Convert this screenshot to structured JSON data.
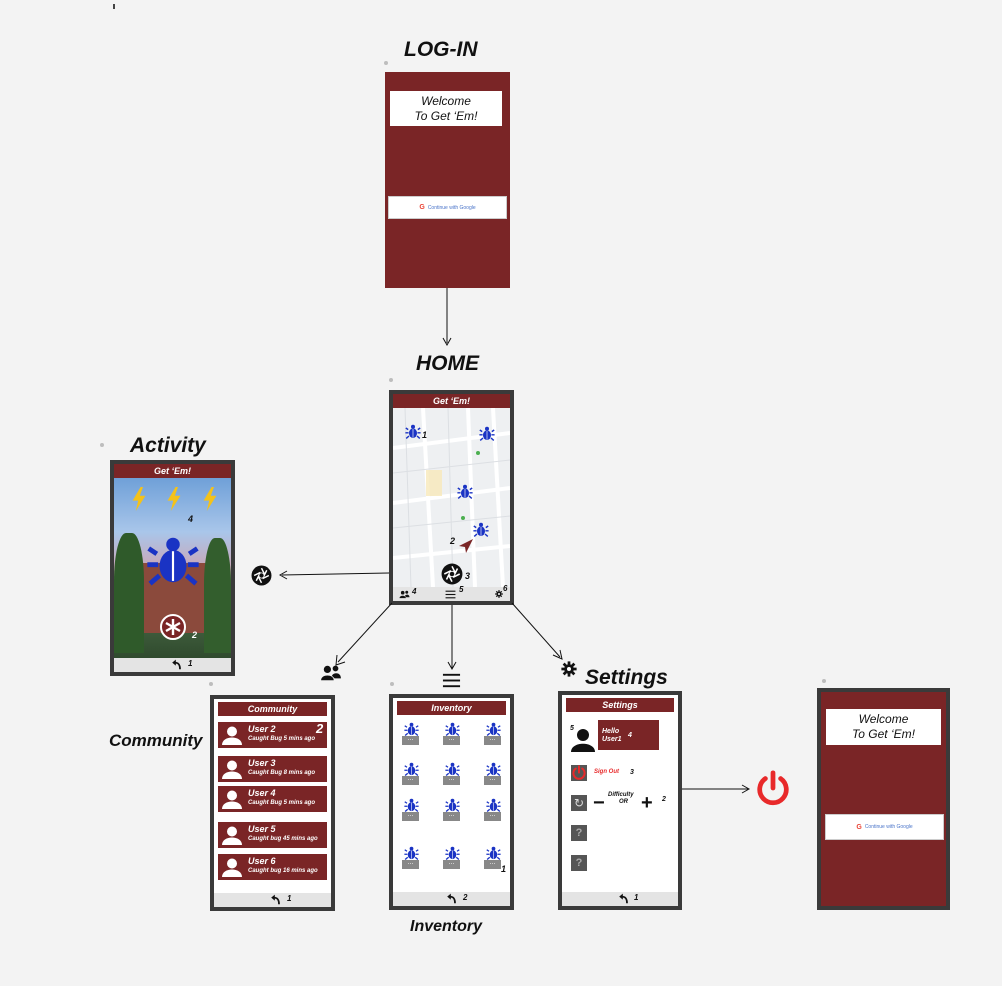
{
  "titles": {
    "login": "LOG-IN",
    "home": "HOME",
    "activity": "Activity",
    "community": "Community",
    "inventory": "Inventory",
    "settings": "Settings"
  },
  "login": {
    "welcome_line1": "Welcome",
    "welcome_line2": "To Get ‘Em!",
    "google_label": "Continue with Google"
  },
  "home": {
    "app_title": "Get ‘Em!",
    "labels": {
      "bug1": "1",
      "arrow": "2",
      "camera": "3",
      "nav_community": "4",
      "nav_inventory": "5",
      "nav_settings": "6"
    }
  },
  "activity": {
    "app_title": "Get ‘Em!",
    "energy_label": "4",
    "capture_label": "2",
    "back_label": "1"
  },
  "community": {
    "header": "Community",
    "badge": "2",
    "back_label": "1",
    "users": [
      {
        "name": "User 2",
        "status": "Caught Bug 5 mins ago"
      },
      {
        "name": "User 3",
        "status": "Caught Bug 8 mins ago"
      },
      {
        "name": "User 4",
        "status": "Caught Bug 5 mins ago"
      },
      {
        "name": "User 5",
        "status": "Caught bug 45 mins ago"
      },
      {
        "name": "User 6",
        "status": "Caught bug 16 mins ago"
      }
    ]
  },
  "inventory": {
    "header": "Inventory",
    "item_button": "...",
    "label_item": "1",
    "back_label": "2"
  },
  "settings": {
    "header": "Settings",
    "hello_line1": "Hello",
    "hello_line2": "User1",
    "label_profile": "5",
    "label_hello": "4",
    "signout": "Sign Out",
    "label_signout": "3",
    "difficulty": "Difficulty",
    "difficulty_or": "OR",
    "label_difficulty": "2",
    "question": "?",
    "back_label": "1"
  },
  "logout_screen": {
    "welcome_line1": "Welcome",
    "welcome_line2": "To Get ‘Em!",
    "google_label": "Continue with Google"
  },
  "colors": {
    "maroon": "#7a2526",
    "bug": "#1a33c4",
    "bolt": "#f4c21a",
    "power": "#e8292a"
  }
}
